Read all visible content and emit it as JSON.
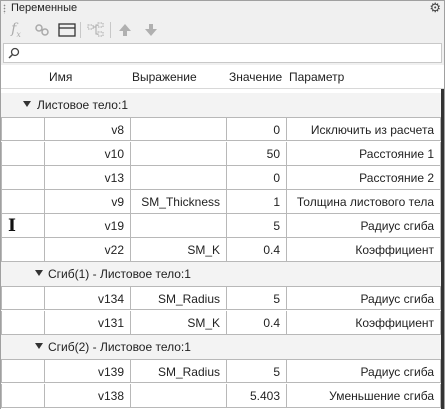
{
  "window": {
    "title": "Переменные",
    "settings_icon": "gear-icon"
  },
  "toolbar": {
    "buttons": [
      {
        "name": "fx-button",
        "icon": "function-icon"
      },
      {
        "name": "link-button",
        "icon": "link-icon"
      },
      {
        "name": "table-view-button",
        "icon": "table-icon"
      },
      {
        "name": "tree-button",
        "icon": "tree-icon"
      },
      {
        "name": "move-up-button",
        "icon": "arrow-up-icon"
      },
      {
        "name": "move-down-button",
        "icon": "arrow-down-icon"
      }
    ]
  },
  "search": {
    "placeholder": "",
    "value": ""
  },
  "columns": {
    "name": "Имя",
    "expression": "Выражение",
    "value": "Значение",
    "parameter": "Параметр"
  },
  "groups": [
    {
      "label": "Листовое тело:1",
      "rows": [
        {
          "name": "v8",
          "expression": "",
          "value": "0",
          "parameter": "Исключить из расчета"
        },
        {
          "name": "v10",
          "expression": "",
          "value": "50",
          "parameter": "Расстояние 1"
        },
        {
          "name": "v13",
          "expression": "",
          "value": "0",
          "parameter": "Расстояние 2"
        },
        {
          "name": "v9",
          "expression": "SM_Thickness",
          "value": "1",
          "parameter": "Толщина листового тела"
        },
        {
          "name": "v19",
          "expression": "",
          "value": "5",
          "parameter": "Радиус сгиба"
        },
        {
          "name": "v22",
          "expression": "SM_K",
          "value": "0.4",
          "parameter": "Коэффициент"
        }
      ]
    },
    {
      "label": "Сгиб(1) - Листовое тело:1",
      "rows": [
        {
          "name": "v134",
          "expression": "SM_Radius",
          "value": "5",
          "parameter": "Радиус сгиба"
        },
        {
          "name": "v131",
          "expression": "SM_K",
          "value": "0.4",
          "parameter": "Коэффициент"
        }
      ]
    },
    {
      "label": "Сгиб(2) - Листовое тело:1",
      "rows": [
        {
          "name": "v139",
          "expression": "SM_Radius",
          "value": "5",
          "parameter": "Радиус сгиба"
        },
        {
          "name": "v138",
          "expression": "",
          "value": "5.403",
          "parameter": "Уменьшение сгиба"
        }
      ]
    }
  ]
}
